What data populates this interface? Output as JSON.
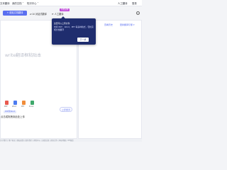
{
  "topnav": {
    "logo_text": "文本翻译",
    "items": [
      "我的文档 ˅",
      "知识中心 ˅"
    ],
    "human_translate": "人工翻译",
    "login": "登录"
  },
  "toolbar": {
    "primary_button": "+ 粘贴文档翻译",
    "link1": "⇄ AI 对话式翻译",
    "badge": "免费试用",
    "link2": "⟳ 人工翻译",
    "help": "?"
  },
  "editor": {
    "placeholder": "write翻译框粘贴本",
    "drop_label": "点击或拖拽到此处上传",
    "file_types": [
      "PDF",
      "Word",
      "PPT",
      "Excel"
    ],
    "tag": "PDF转Word",
    "translate_button": "立即翻译"
  },
  "rightpanel": {
    "link1": "查看历史",
    "link2": "更换翻译引擎 ▾"
  },
  "tooltip": {
    "title": "这里可以上传文件",
    "body": "支持 PDF、Word、PPT 等多种格式，轻松完成文档翻译",
    "next": "下一步"
  },
  "footer": {
    "text": "关于我们 | 用户协议 | 隐私政策 | 联系我们 | 帮助中心 | 意见反馈 | 商务合作 | 网站地图 | ICP备案"
  },
  "colors": {
    "accent": "#5a6ff0",
    "badge": "#c04bd9",
    "tooltip_bg": "#1f2d6e"
  }
}
